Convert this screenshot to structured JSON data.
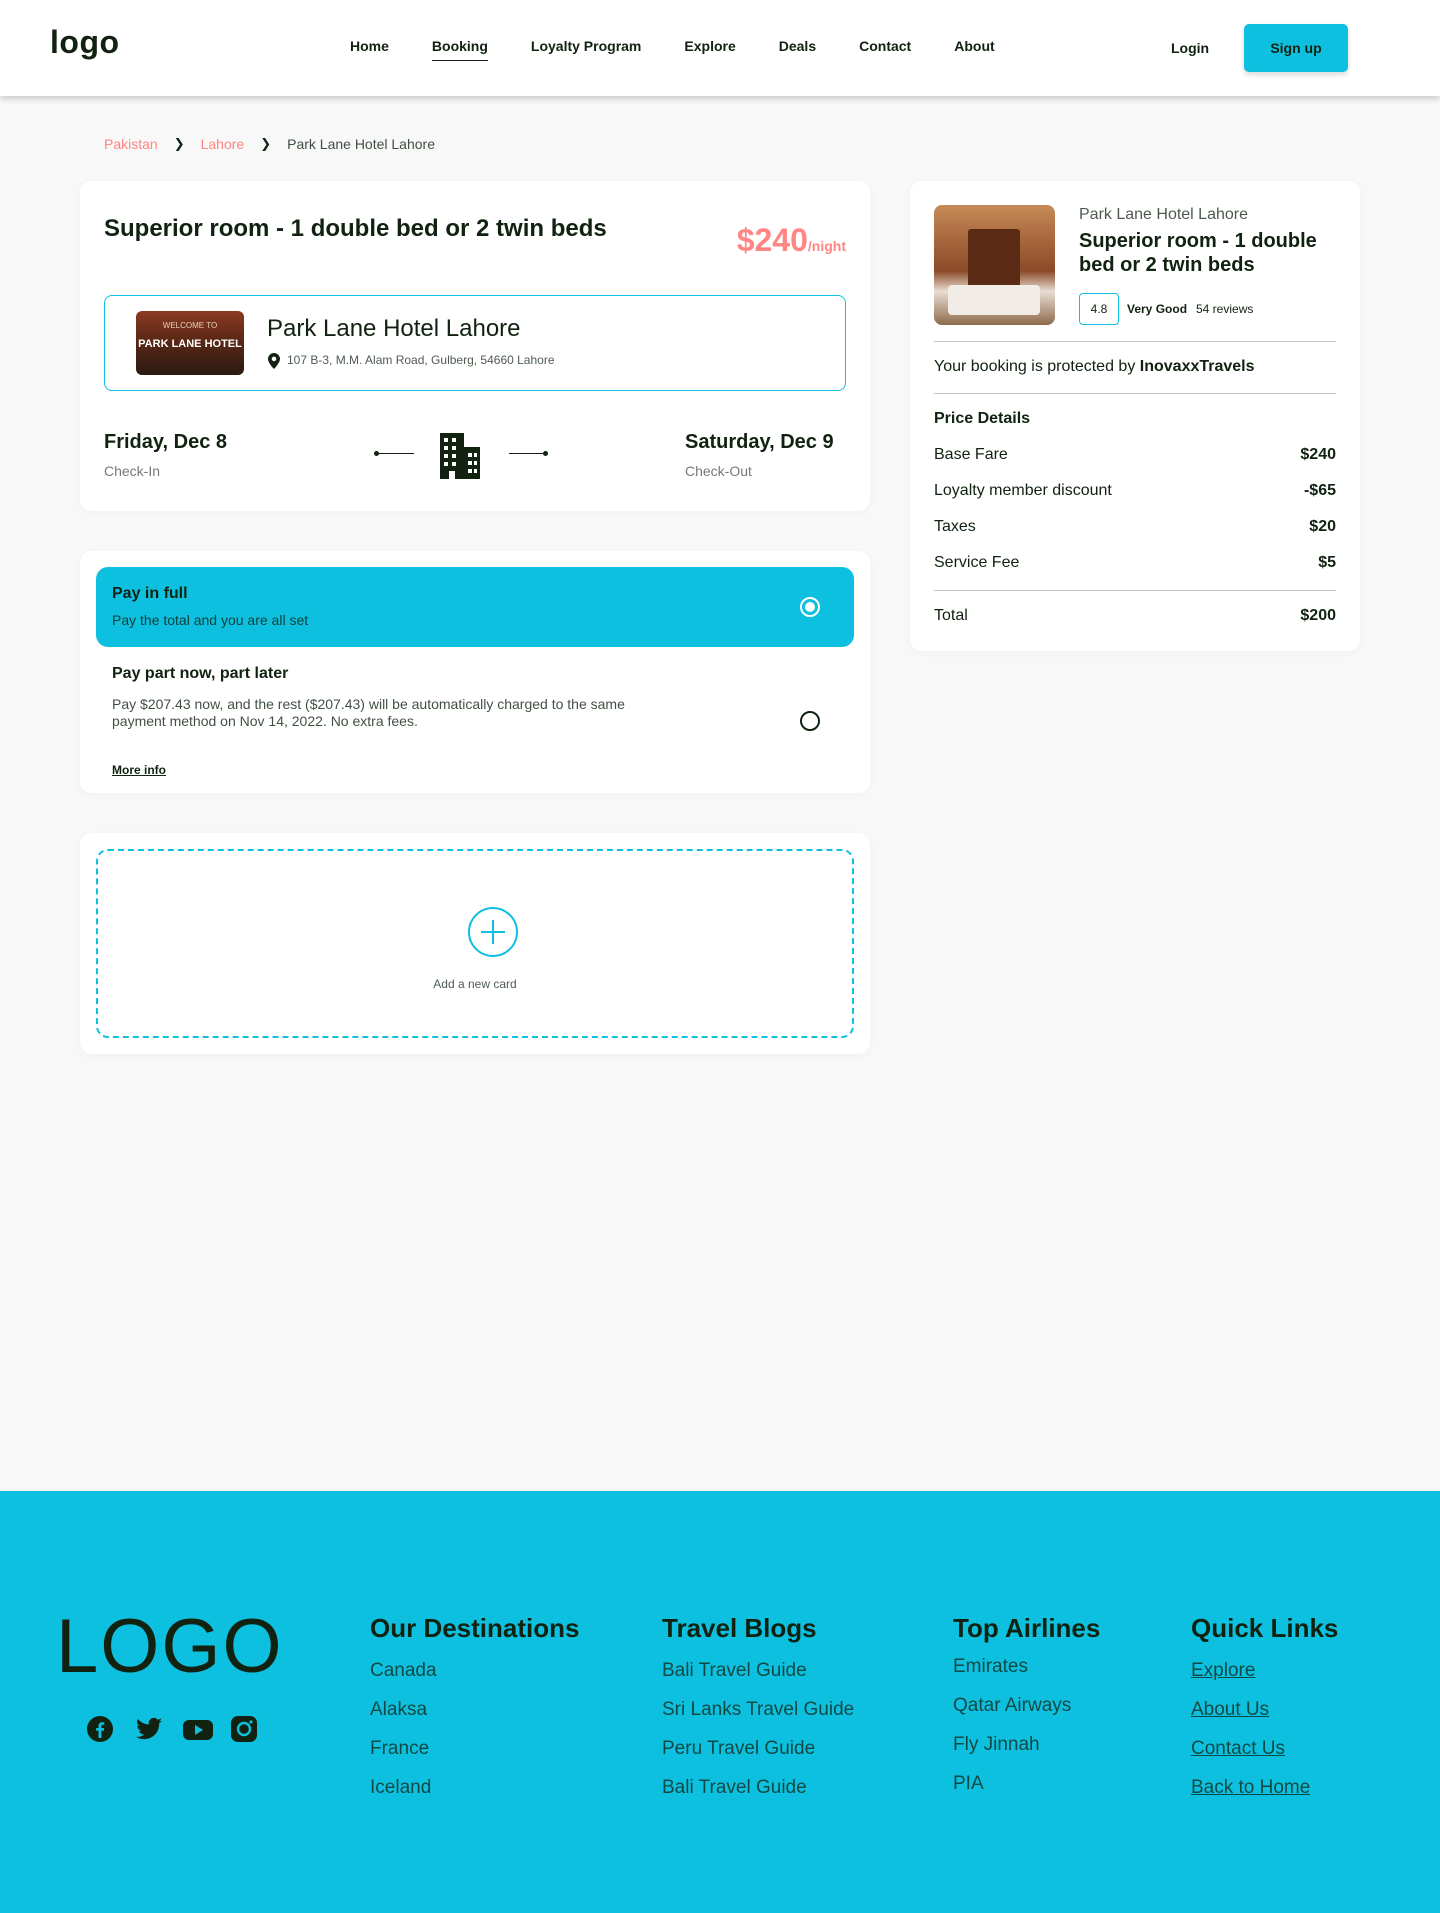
{
  "nav": {
    "logo": "logo",
    "items": [
      {
        "label": "Home",
        "active": false
      },
      {
        "label": "Booking",
        "active": true
      },
      {
        "label": "Loyalty Program",
        "active": false
      },
      {
        "label": "Explore",
        "active": false
      },
      {
        "label": "Deals",
        "active": false
      },
      {
        "label": "Contact",
        "active": false
      },
      {
        "label": "About",
        "active": false
      }
    ],
    "login": "Login",
    "signup": "Sign up"
  },
  "breadcrumb": [
    "Pakistan",
    "Lahore",
    "Park Lane Hotel Lahore"
  ],
  "room": {
    "title": "Superior room - 1 double bed or 2 twin beds",
    "price": "$240",
    "per": "/night",
    "hotel_name": "Park Lane Hotel Lahore",
    "address": "107 B-3, M.M. Alam Road, Gulberg, 54660 Lahore",
    "thumb_text_top": "WELCOME TO",
    "thumb_text_main": "PARK LANE HOTEL",
    "checkin_date": "Friday, Dec 8",
    "checkin_label": "Check-In",
    "checkout_date": "Saturday, Dec 9",
    "checkout_label": "Check-Out"
  },
  "payment": {
    "full_title": "Pay in full",
    "full_sub": "Pay the total and you are all set",
    "part_title": "Pay part now, part later",
    "part_sub_line1": "Pay $207.43 now, and the rest ($207.43) will be automatically charged to the same",
    "part_sub_line2": "payment method on Nov 14, 2022. No extra fees.",
    "more_info": "More info"
  },
  "add_card": {
    "label": "Add a new card"
  },
  "summary": {
    "hotel": "Park Lane Hotel Lahore",
    "room_title": "Superior room - 1 double bed or 2 twin beds",
    "rating": "4.8",
    "rating_label": "Very Good",
    "reviews": "54 reviews",
    "protected_prefix": "Your booking is protected by",
    "protected_brand": "InovaxxTravels",
    "price_details_title": "Price Details",
    "rows": [
      {
        "label": "Base Fare",
        "value": "$240"
      },
      {
        "label": "Loyalty member discount",
        "value": "-$65"
      },
      {
        "label": "Taxes",
        "value": "$20"
      },
      {
        "label": "Service Fee",
        "value": "$5"
      }
    ],
    "total_label": "Total",
    "total_value": "$200"
  },
  "footer": {
    "logo": "LOGO",
    "social_icons": [
      "facebook-icon",
      "twitter-icon",
      "youtube-icon",
      "instagram-icon"
    ],
    "columns": [
      {
        "title": "Our Destinations",
        "items": [
          "Canada",
          "Alaksa",
          "France",
          "Iceland"
        ]
      },
      {
        "title": "Travel Blogs",
        "items": [
          "Bali Travel Guide",
          "Sri Lanks Travel Guide",
          "Peru Travel Guide",
          "Bali Travel Guide"
        ]
      },
      {
        "title": "Top Airlines",
        "items": [
          "Emirates",
          "Qatar Airways",
          "Fly Jinnah",
          "PIA"
        ]
      },
      {
        "title": "Quick Links",
        "items": [
          "Explore",
          "About Us",
          "Contact Us",
          "Back to Home"
        ]
      }
    ]
  },
  "colors": {
    "accent": "#0ec0df",
    "price": "#ff8682",
    "text": "#112211",
    "background": "#f8f8f8"
  }
}
